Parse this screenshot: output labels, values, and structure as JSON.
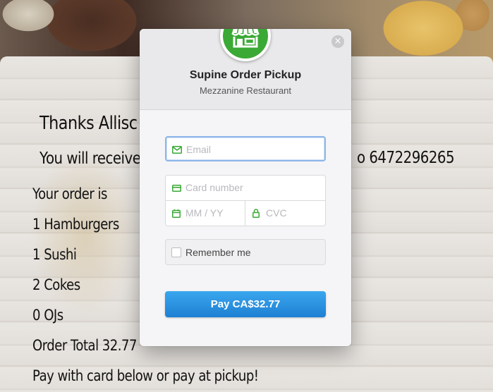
{
  "background": {
    "thanks_text": "Thanks Allisc",
    "receive_text": "You will receive",
    "phone_text": "o 6472296265",
    "order_is": "Your order is",
    "items": [
      "1 Hamburgers",
      "1 Sushi",
      "2 Cokes",
      "0 OJs"
    ],
    "order_total": "Order Total 32.77",
    "pay_note": "Pay with card below or pay at pickup!"
  },
  "modal": {
    "title": "Supine Order Pickup",
    "subtitle": "Mezzanine Restaurant",
    "close_glyph": "×",
    "logo_icon": "store-icon",
    "email_placeholder": "Email",
    "card_placeholder": "Card number",
    "expiry_placeholder": "MM / YY",
    "cvc_placeholder": "CVC",
    "remember_label": "Remember me",
    "pay_button": "Pay CA$32.77",
    "colors": {
      "logo_green": "#3aa935",
      "icon_green": "#3aa935",
      "pay_button_blue": "#2590e0",
      "focus_border": "#8fb6e8"
    }
  }
}
